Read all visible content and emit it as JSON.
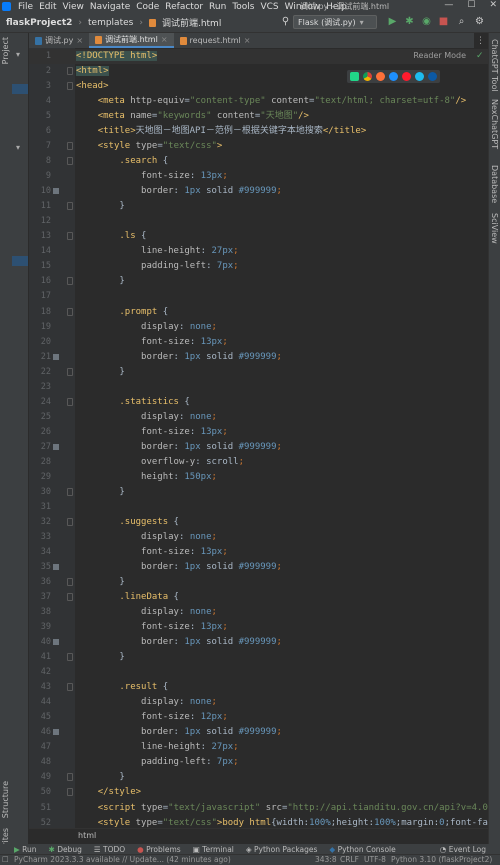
{
  "menu": [
    "File",
    "Edit",
    "View",
    "Navigate",
    "Code",
    "Refactor",
    "Run",
    "Tools",
    "VCS",
    "Window",
    "Help"
  ],
  "window_title": "调试.py - 调试前端.html",
  "breadcrumbs": [
    "flaskProject2",
    "templates",
    "调试前端.html"
  ],
  "run_config": "Flask (调试.py)",
  "left_tools": [
    "Project",
    "Structure",
    "Favorites"
  ],
  "right_tools": [
    "ChatGPT Tool",
    "NexChatGPT",
    "Database",
    "SciView"
  ],
  "tabs": [
    {
      "label": "调试.py",
      "active": false
    },
    {
      "label": "调试前端.html",
      "active": true
    },
    {
      "label": "request.html",
      "active": false
    }
  ],
  "reader_mode": "Reader Mode",
  "browser_icons": [
    "pycharm-browser-icon",
    "chrome-icon",
    "firefox-icon",
    "safari-icon",
    "opera-icon",
    "ie-icon",
    "edge-icon"
  ],
  "code_lines": [
    {
      "n": "1",
      "html": "<span class='hl'><span class='tag'>&lt;!DOCTYPE html&gt;</span></span>"
    },
    {
      "n": "2",
      "html": "<span class='hl'><span class='tag'>&lt;html&gt;</span></span>"
    },
    {
      "n": "3",
      "html": "<span class='tag'>&lt;head&gt;</span>"
    },
    {
      "n": "4",
      "html": "    <span class='tag'>&lt;meta </span><span class='attr'>http-equiv</span><span class='txt'>=</span><span class='str'>\"content-type\"</span><span class='attr'> content</span><span class='txt'>=</span><span class='str'>\"text/html; charset=utf-8\"</span><span class='tag'>/&gt;</span>"
    },
    {
      "n": "5",
      "html": "    <span class='tag'>&lt;meta </span><span class='attr'>name</span><span class='txt'>=</span><span class='str'>\"keywords\"</span><span class='attr'> content</span><span class='txt'>=</span><span class='str'>\"天地图\"</span><span class='tag'>/&gt;</span>"
    },
    {
      "n": "6",
      "html": "    <span class='tag'>&lt;title&gt;</span><span class='txt'>天地图－地图API－范例－根据关键字本地搜索</span><span class='tag'>&lt;/title&gt;</span>"
    },
    {
      "n": "7",
      "html": "    <span class='tag'>&lt;style </span><span class='attr'>type</span><span class='txt'>=</span><span class='str'>\"text/css\"</span><span class='tag'>&gt;</span>"
    },
    {
      "n": "8",
      "html": "        <span class='sel'>.search </span><span class='txt'>{</span>"
    },
    {
      "n": "9",
      "html": "            <span class='prop'>font-size</span><span class='txt'>: </span><span class='num'>13px</span><span class='kw'>;</span>"
    },
    {
      "n": "10",
      "html": "            <span class='prop'>border</span><span class='txt'>: </span><span class='num'>1px </span><span class='txt'>solid </span><span class='num'>#999999</span><span class='kw'>;</span>"
    },
    {
      "n": "11",
      "html": "        <span class='txt'>}</span>"
    },
    {
      "n": "12",
      "html": ""
    },
    {
      "n": "13",
      "html": "        <span class='sel'>.ls </span><span class='txt'>{</span>"
    },
    {
      "n": "14",
      "html": "            <span class='prop'>line-height</span><span class='txt'>: </span><span class='num'>27px</span><span class='kw'>;</span>"
    },
    {
      "n": "15",
      "html": "            <span class='prop'>padding-left</span><span class='txt'>: </span><span class='num'>7px</span><span class='kw'>;</span>"
    },
    {
      "n": "16",
      "html": "        <span class='txt'>}</span>"
    },
    {
      "n": "17",
      "html": ""
    },
    {
      "n": "18",
      "html": "        <span class='sel'>.prompt </span><span class='txt'>{</span>"
    },
    {
      "n": "19",
      "html": "            <span class='prop'>display</span><span class='txt'>: </span><span class='num'>none</span><span class='kw'>;</span>"
    },
    {
      "n": "20",
      "html": "            <span class='prop'>font-size</span><span class='txt'>: </span><span class='num'>13px</span><span class='kw'>;</span>"
    },
    {
      "n": "21",
      "html": "            <span class='prop'>border</span><span class='txt'>: </span><span class='num'>1px </span><span class='txt'>solid </span><span class='num'>#999999</span><span class='kw'>;</span>"
    },
    {
      "n": "22",
      "html": "        <span class='txt'>}</span>"
    },
    {
      "n": "23",
      "html": ""
    },
    {
      "n": "24",
      "html": "        <span class='sel'>.statistics </span><span class='txt'>{</span>"
    },
    {
      "n": "25",
      "html": "            <span class='prop'>display</span><span class='txt'>: </span><span class='num'>none</span><span class='kw'>;</span>"
    },
    {
      "n": "26",
      "html": "            <span class='prop'>font-size</span><span class='txt'>: </span><span class='num'>13px</span><span class='kw'>;</span>"
    },
    {
      "n": "27",
      "html": "            <span class='prop'>border</span><span class='txt'>: </span><span class='num'>1px </span><span class='txt'>solid </span><span class='num'>#999999</span><span class='kw'>;</span>"
    },
    {
      "n": "28",
      "html": "            <span class='prop'>overflow-y</span><span class='txt'>: </span><span class='txt'>scroll</span><span class='kw'>;</span>"
    },
    {
      "n": "29",
      "html": "            <span class='prop'>height</span><span class='txt'>: </span><span class='num'>150px</span><span class='kw'>;</span>"
    },
    {
      "n": "30",
      "html": "        <span class='txt'>}</span>"
    },
    {
      "n": "31",
      "html": ""
    },
    {
      "n": "32",
      "html": "        <span class='sel'>.suggests </span><span class='txt'>{</span>"
    },
    {
      "n": "33",
      "html": "            <span class='prop'>display</span><span class='txt'>: </span><span class='num'>none</span><span class='kw'>;</span>"
    },
    {
      "n": "34",
      "html": "            <span class='prop'>font-size</span><span class='txt'>: </span><span class='num'>13px</span><span class='kw'>;</span>"
    },
    {
      "n": "35",
      "html": "            <span class='prop'>border</span><span class='txt'>: </span><span class='num'>1px </span><span class='txt'>solid </span><span class='num'>#999999</span><span class='kw'>;</span>"
    },
    {
      "n": "36",
      "html": "        <span class='txt'>}</span>"
    },
    {
      "n": "37",
      "html": "        <span class='sel'>.lineData </span><span class='txt'>{</span>"
    },
    {
      "n": "38",
      "html": "            <span class='prop'>display</span><span class='txt'>: </span><span class='num'>none</span><span class='kw'>;</span>"
    },
    {
      "n": "39",
      "html": "            <span class='prop'>font-size</span><span class='txt'>: </span><span class='num'>13px</span><span class='kw'>;</span>"
    },
    {
      "n": "40",
      "html": "            <span class='prop'>border</span><span class='txt'>: </span><span class='num'>1px </span><span class='txt'>solid </span><span class='num'>#999999</span><span class='kw'>;</span>"
    },
    {
      "n": "41",
      "html": "        <span class='txt'>}</span>"
    },
    {
      "n": "42",
      "html": ""
    },
    {
      "n": "43",
      "html": "        <span class='sel'>.result </span><span class='txt'>{</span>"
    },
    {
      "n": "44",
      "html": "            <span class='prop'>display</span><span class='txt'>: </span><span class='num'>none</span><span class='kw'>;</span>"
    },
    {
      "n": "45",
      "html": "            <span class='prop'>font-size</span><span class='txt'>: </span><span class='num'>12px</span><span class='kw'>;</span>"
    },
    {
      "n": "46",
      "html": "            <span class='prop'>border</span><span class='txt'>: </span><span class='num'>1px </span><span class='txt'>solid </span><span class='num'>#999999</span><span class='kw'>;</span>"
    },
    {
      "n": "47",
      "html": "            <span class='prop'>line-height</span><span class='txt'>: </span><span class='num'>27px</span><span class='kw'>;</span>"
    },
    {
      "n": "48",
      "html": "            <span class='prop'>padding-left</span><span class='txt'>: </span><span class='num'>7px</span><span class='kw'>;</span>"
    },
    {
      "n": "49",
      "html": "        <span class='txt'>}</span>"
    },
    {
      "n": "50",
      "html": "    <span class='tag'>&lt;/style&gt;</span>"
    },
    {
      "n": "51",
      "html": "    <span class='tag'>&lt;script </span><span class='attr'>type</span><span class='txt'>=</span><span class='str'>\"text/javascript\"</span><span class='attr'> src</span><span class='txt'>=</span><span class='str'>\"http://api.tianditu.gov.cn/api?v=4.0&amp;tk=7</span>"
    },
    {
      "n": "52",
      "html": "    <span class='tag'>&lt;style </span><span class='attr'>type</span><span class='txt'>=</span><span class='str'>\"text/css\"</span><span class='tag'>&gt;</span><span class='sel'>body html</span><span class='txt'>{width:</span><span class='num'>100%</span><span class='txt'>;height:</span><span class='num'>100%</span><span class='txt'>;margin:</span><span class='num'>0</span><span class='txt'>;font-family:</span>"
    }
  ],
  "bookmarked_lines": [
    "10",
    "21",
    "27",
    "35",
    "40",
    "46"
  ],
  "editor_breadcrumb": "html",
  "bottom_tools": [
    "Run",
    "Debug",
    "TODO",
    "Problems",
    "Terminal",
    "Python Packages",
    "Python Console",
    "Event Log"
  ],
  "status": {
    "message": "PyCharm 2023.3.3 available // Update... (42 minutes ago)",
    "position": "343:8",
    "line_sep": "CRLF",
    "encoding": "UTF-8",
    "interpreter": "Python 3.10 (flaskProject2)"
  }
}
